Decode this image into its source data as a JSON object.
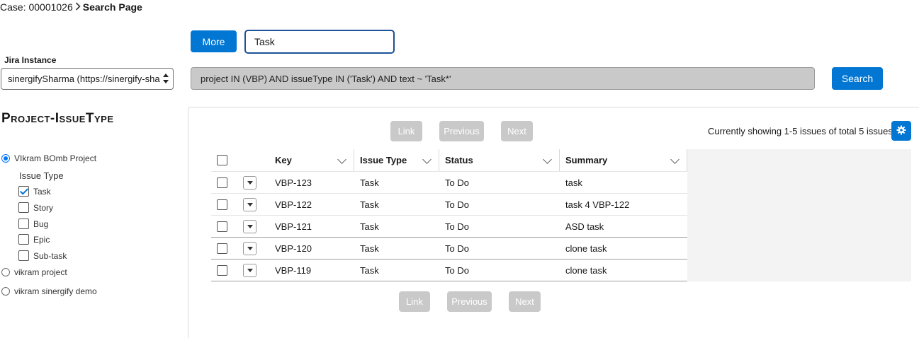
{
  "breadcrumb": {
    "case": "Case: 00001026",
    "separator": ">",
    "current": "Search Page"
  },
  "toolbar": {
    "more_label": "More",
    "search_value": "Task",
    "search_label": "Search"
  },
  "jira": {
    "label": "Jira Instance",
    "selected": "sinergifySharma (https://sinergify-sha"
  },
  "jql": "project IN (VBP) AND issueType IN ('Task') AND text ~ 'Task*'",
  "sidebar": {
    "title": "Project-IssueType",
    "projects": [
      {
        "label": "VIkram BOmb Project",
        "checked": true
      },
      {
        "label": "vikram project",
        "checked": false
      },
      {
        "label": "vikram sinergify demo",
        "checked": false
      }
    ],
    "issue_type_label": "Issue Type",
    "issue_types": [
      {
        "label": "Task",
        "checked": true
      },
      {
        "label": "Story",
        "checked": false
      },
      {
        "label": "Bug",
        "checked": false
      },
      {
        "label": "Epic",
        "checked": false
      },
      {
        "label": "Sub-task",
        "checked": false
      }
    ]
  },
  "pager": {
    "link": "Link",
    "previous": "Previous",
    "next": "Next"
  },
  "results": {
    "count_text": "Currently showing 1-5 issues of total 5 issues",
    "columns": [
      "Key",
      "Issue Type",
      "Status",
      "Summary"
    ],
    "rows": [
      {
        "key": "VBP-123",
        "type": "Task",
        "status": "To Do",
        "summary": "task"
      },
      {
        "key": "VBP-122",
        "type": "Task",
        "status": "To Do",
        "summary": "task 4 VBP-122"
      },
      {
        "key": "VBP-121",
        "type": "Task",
        "status": "To Do",
        "summary": "ASD task"
      },
      {
        "key": "VBP-120",
        "type": "Task",
        "status": "To Do",
        "summary": "clone task"
      },
      {
        "key": "VBP-119",
        "type": "Task",
        "status": "To Do",
        "summary": "clone task"
      }
    ]
  },
  "colors": {
    "brand": "#0176d3",
    "disabled": "#c9c9c9",
    "input_focus": "#1b5297"
  }
}
